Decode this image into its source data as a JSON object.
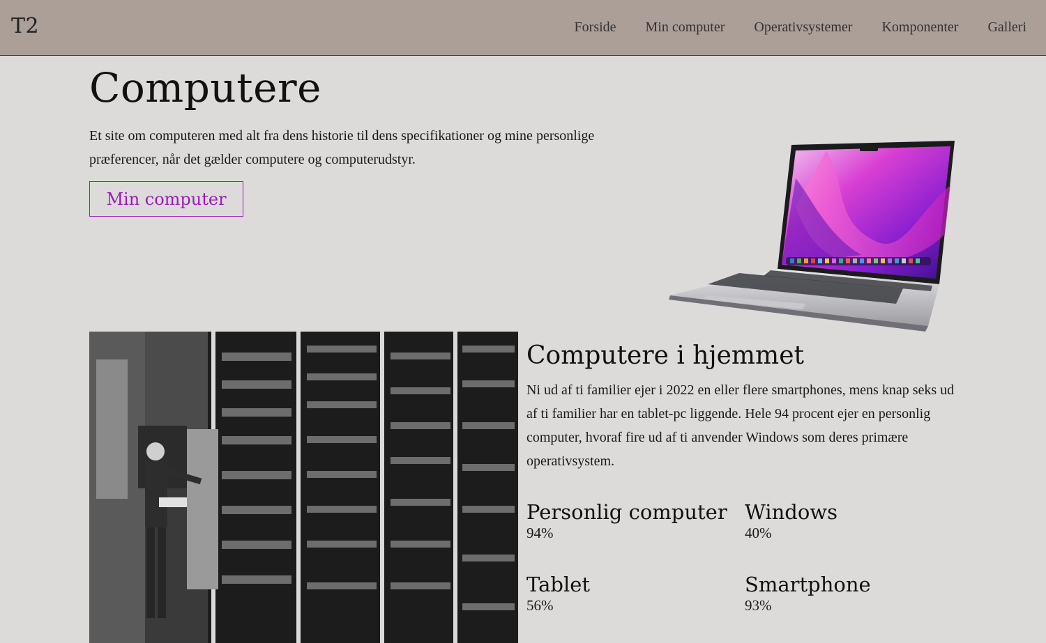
{
  "header": {
    "logo": "T2",
    "nav": [
      "Forside",
      "Min computer",
      "Operativsystemer",
      "Komponenter",
      "Galleri"
    ]
  },
  "hero": {
    "title": "Computere",
    "text": "Et site om computeren med alt fra dens historie til dens specifikationer og mine personlige præferencer, når det gælder computere og computerudstyr.",
    "button_label": "Min computer"
  },
  "section": {
    "title": "Computere i hjemmet",
    "text": "Ni ud af ti familier ejer i 2022 en eller flere smartphones, mens knap seks ud af ti familier har en tablet-pc liggende. Hele 94 procent ejer en personlig computer, hvoraf fire ud af ti anvender Windows som deres primære operativsystem.",
    "stats": [
      {
        "label": "Personlig computer",
        "value": "94%"
      },
      {
        "label": "Windows",
        "value": "40%"
      },
      {
        "label": "Tablet",
        "value": "56%"
      },
      {
        "label": "Smartphone",
        "value": "93%"
      }
    ]
  },
  "colors": {
    "header_bg": "#ab9f98",
    "page_bg": "#dcdbda",
    "accent": "#9b1bb6"
  }
}
